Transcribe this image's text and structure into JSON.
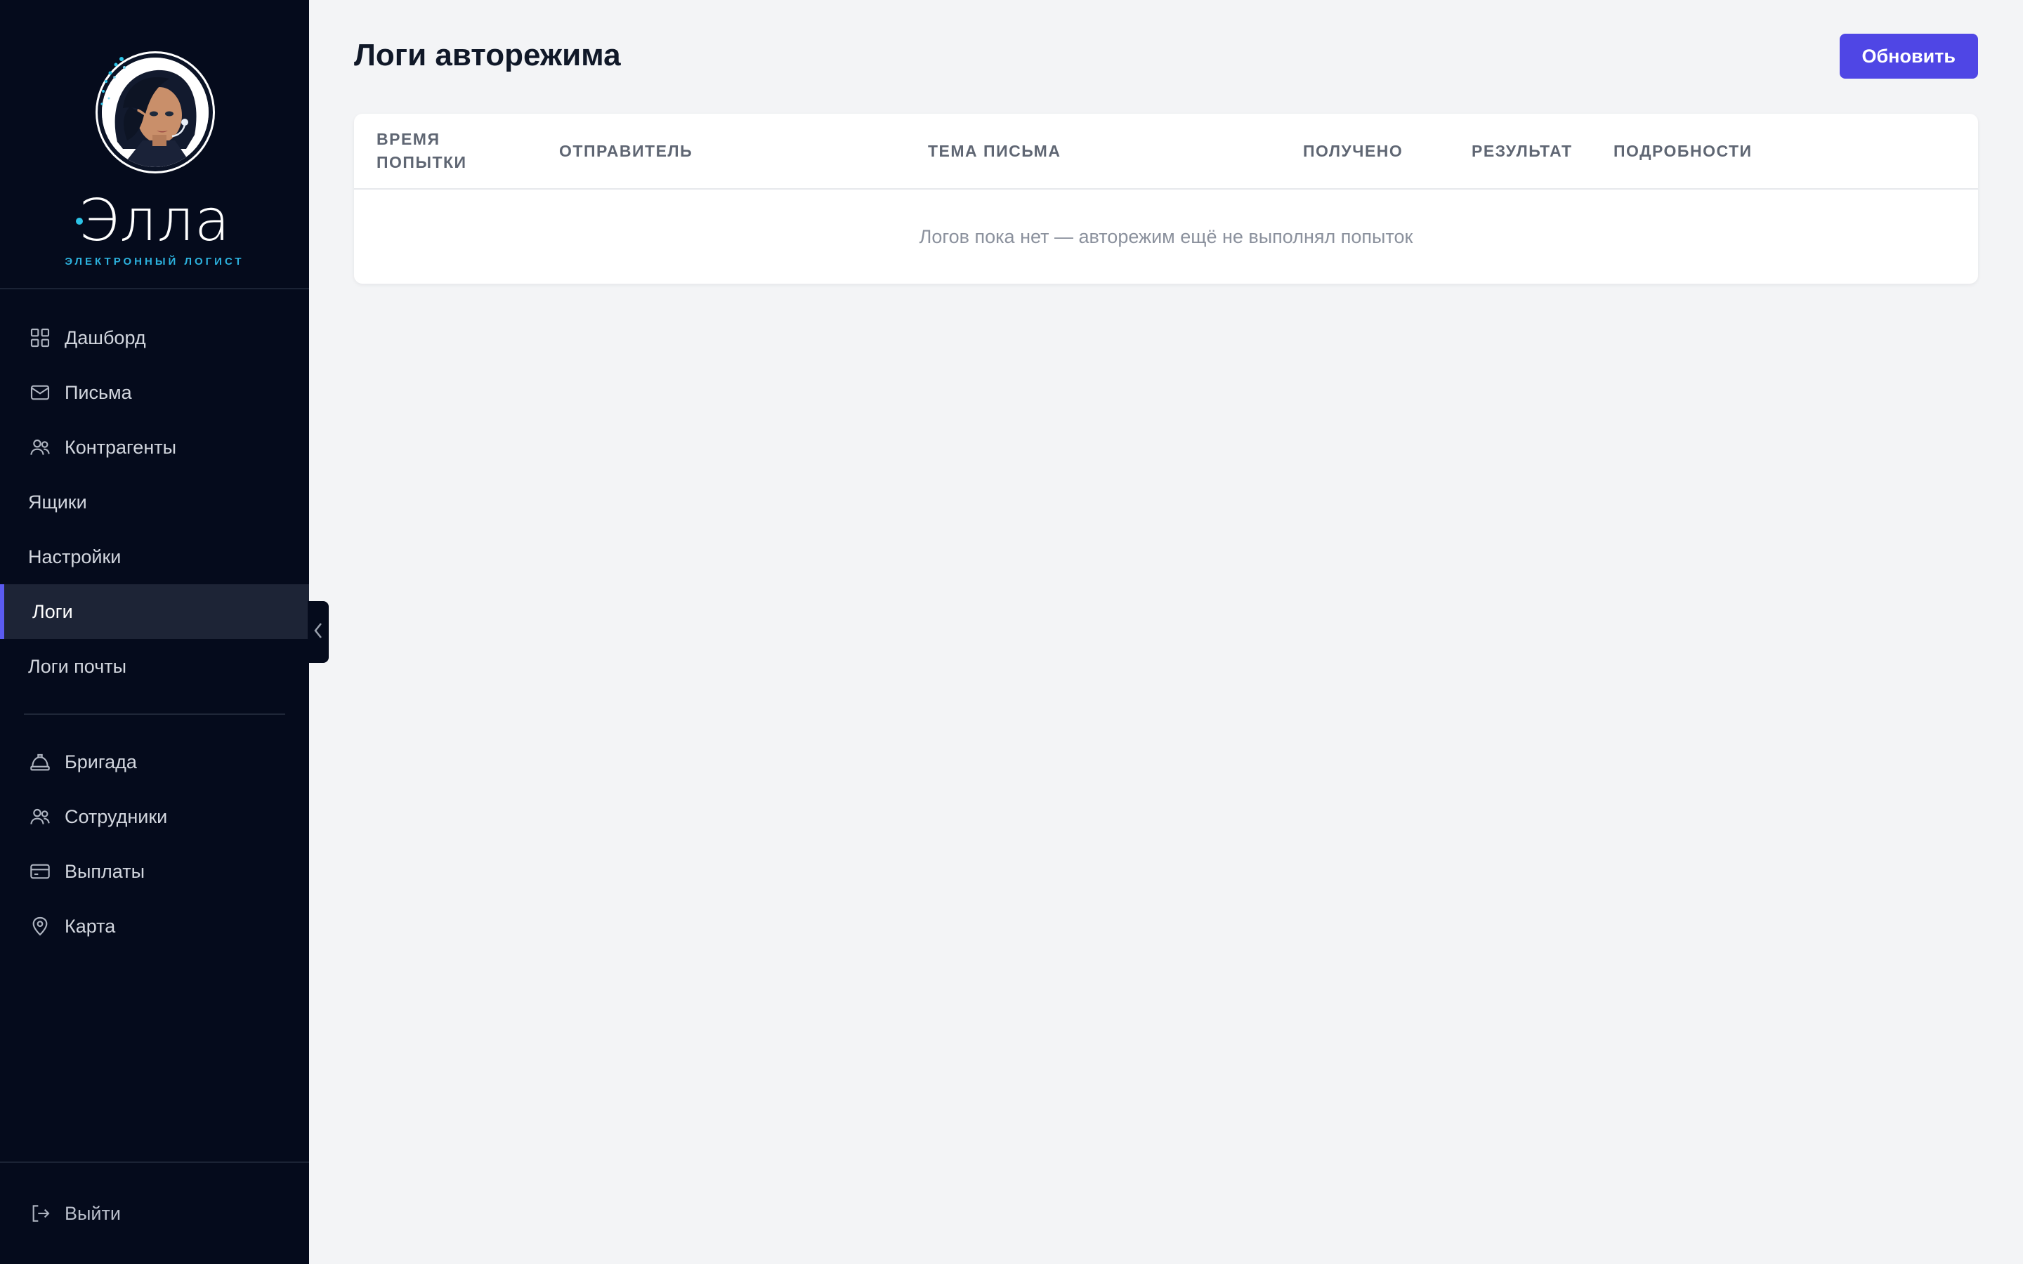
{
  "brand": {
    "name": "Элла",
    "subtitle": "ЭЛЕКТРОННЫЙ ЛОГИСТ"
  },
  "sidebar": {
    "items": [
      {
        "label": "Дашборд",
        "icon": "grid-icon"
      },
      {
        "label": "Письма",
        "icon": "mail-icon"
      },
      {
        "label": "Контрагенты",
        "icon": "users-icon"
      },
      {
        "label": "Ящики",
        "icon": ""
      },
      {
        "label": "Настройки",
        "icon": ""
      },
      {
        "label": "Логи",
        "icon": "",
        "active": true
      },
      {
        "label": "Логи почты",
        "icon": ""
      }
    ],
    "items2": [
      {
        "label": "Бригада",
        "icon": "hard-hat-icon"
      },
      {
        "label": "Сотрудники",
        "icon": "users-icon"
      },
      {
        "label": "Выплаты",
        "icon": "credit-card-icon"
      },
      {
        "label": "Карта",
        "icon": "map-pin-icon"
      }
    ],
    "logout": {
      "label": "Выйти",
      "icon": "logout-icon"
    }
  },
  "header": {
    "title": "Логи авторежима",
    "refresh_label": "Обновить"
  },
  "table": {
    "columns": [
      "ВРЕМЯ\nПОПЫТКИ",
      "ОТПРАВИТЕЛЬ",
      "ТЕМА ПИСЬМА",
      "ПОЛУЧЕНО",
      "РЕЗУЛЬТАТ",
      "ПОДРОБНОСТИ"
    ],
    "empty_message": "Логов пока нет — авторежим ещё не выполнял попыток"
  },
  "colors": {
    "sidebar_bg": "#050b1c",
    "accent": "#4f46e5",
    "active_bar": "#5b5bf0",
    "brand_sub": "#2cb2de"
  }
}
